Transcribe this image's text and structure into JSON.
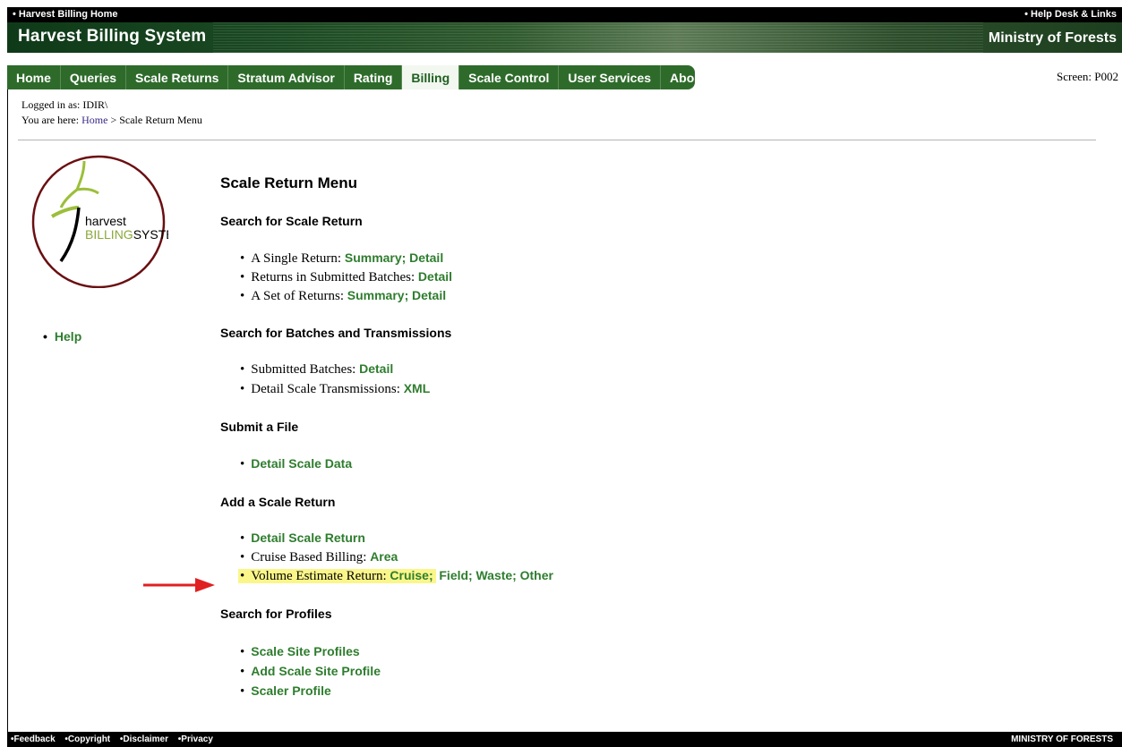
{
  "topbar": {
    "left_link": "• Harvest Billing Home",
    "right_link": "• Help Desk & Links"
  },
  "banner": {
    "title": "Harvest Billing System",
    "ministry": "Ministry of Forests"
  },
  "nav": {
    "tabs": [
      {
        "label": "Home"
      },
      {
        "label": "Queries"
      },
      {
        "label": "Scale Returns"
      },
      {
        "label": "Stratum Advisor"
      },
      {
        "label": "Rating"
      },
      {
        "label": "Billing"
      },
      {
        "label": "Scale Control"
      },
      {
        "label": "User Services"
      },
      {
        "label": "About"
      }
    ],
    "active": "Billing"
  },
  "screen_id": "Screen: P002",
  "session": {
    "logged_in": "Logged in as: IDIR\\",
    "breadcrumb_prefix": "You are here: ",
    "breadcrumb_home": "Home",
    "breadcrumb_rest": " > Scale Return Menu"
  },
  "logo": {
    "text_top": "harvest",
    "text_bottom_green": "BILLING",
    "text_bottom_black": "SYSTEM"
  },
  "sidebar": {
    "help_label": "Help"
  },
  "main": {
    "title": "Scale Return Menu",
    "sections": {
      "search_scale": {
        "heading": "Search for Scale Return",
        "single": {
          "label": "A Single Return: ",
          "summary": "Summary;",
          "detail": "Detail"
        },
        "submitted": {
          "label": "Returns in Submitted Batches: ",
          "detail": "Detail"
        },
        "set": {
          "label": "A Set of Returns: ",
          "summary": "Summary;",
          "detail": "Detail"
        }
      },
      "search_batches": {
        "heading": "Search for Batches and Transmissions",
        "submitted_batches": {
          "label": "Submitted Batches: ",
          "detail": "Detail"
        },
        "transmissions": {
          "label": "Detail Scale Transmissions: ",
          "xml": "XML"
        }
      },
      "submit_file": {
        "heading": "Submit a File",
        "detail_scale_data": "Detail Scale Data"
      },
      "add_return": {
        "heading": "Add a Scale Return",
        "detail_scale_return": "Detail Scale Return",
        "cruise_based": {
          "label": "Cruise Based Billing: ",
          "area": "Area"
        },
        "volume_estimate": {
          "label": "Volume Estimate Return: ",
          "cruise": "Cruise;",
          "field": "Field;",
          "waste": "Waste;",
          "other": "Other"
        }
      },
      "profiles": {
        "heading": "Search for Profiles",
        "scale_site_profiles": "Scale Site Profiles",
        "add_scale_site_profile": "Add Scale Site Profile",
        "scaler_profile": "Scaler Profile"
      }
    }
  },
  "footer": {
    "links": [
      "•Feedback",
      "•Copyright",
      "•Disclaimer",
      "•Privacy"
    ],
    "right": "MINISTRY OF FORESTS"
  },
  "colors": {
    "link_green": "#2e7d2e",
    "nav_green": "#2e6b2b",
    "highlight": "#fbf68a",
    "arrow_red": "#e02020"
  }
}
